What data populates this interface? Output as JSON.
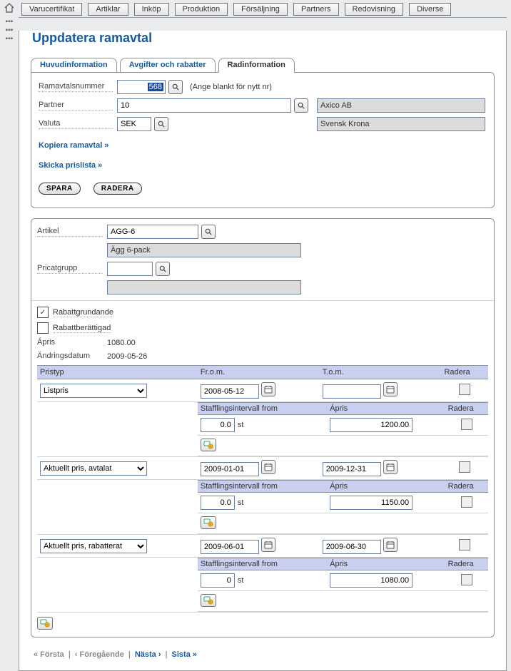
{
  "menu": [
    "Varucertifikat",
    "Artiklar",
    "Inköp",
    "Produktion",
    "Försäljning",
    "Partners",
    "Redovisning",
    "Diverse"
  ],
  "title": "Uppdatera ramavtal",
  "tabs": {
    "t1": "Huvudinformation",
    "t2": "Avgifter och rabatter",
    "t3": "Radinformation"
  },
  "head": {
    "ramavtalsnummer_label": "Ramavtalsnummer",
    "ramavtalsnummer_value": "568",
    "ramavtalsnummer_hint": "(Ange blankt för nytt nr)",
    "partner_label": "Partner",
    "partner_value": "10",
    "partner_name": "Axico AB",
    "valuta_label": "Valuta",
    "valuta_value": "SEK",
    "valuta_name": "Svensk Krona",
    "link_copy": "Kopiera ramavtal »",
    "link_skicka": "Skicka prislista »",
    "btn_save": "SPARA",
    "btn_delete": "RADERA"
  },
  "article": {
    "artikel_label": "Artikel",
    "artikel_value": "AGG-6",
    "artikel_name": "Ägg 6-pack",
    "pricatgrupp_label": "Pricatgrupp",
    "pricatgrupp_value": "",
    "pricatgrupp_name": "",
    "rabattgrund_label": "Rabattgrundande",
    "rabattberatt_label": "Rabattberättigad",
    "apris_label": "Ápris",
    "apris_value": "1080.00",
    "andring_label": "Ändringsdatum",
    "andring_value": "2009-05-26"
  },
  "priceHeaders": {
    "pristyp": "Pristyp",
    "from": "Fr.o.m.",
    "tom": "T.o.m.",
    "radera": "Radera"
  },
  "subHeaders": {
    "stafflings": "Stafflingsintervall from",
    "apris": "Ápris",
    "radera": "Radera"
  },
  "rows": [
    {
      "type": "Listpris",
      "from": "2008-05-12",
      "tom": "",
      "staff": "0.0",
      "unit": "st",
      "apris": "1200.00"
    },
    {
      "type": "Aktuellt pris, avtalat",
      "from": "2009-01-01",
      "tom": "2009-12-31",
      "staff": "0.0",
      "unit": "st",
      "apris": "1150.00"
    },
    {
      "type": "Aktuellt pris, rabatterat",
      "from": "2009-06-01",
      "tom": "2009-06-30",
      "staff": "0",
      "unit": "st",
      "apris": "1080.00"
    }
  ],
  "pager": {
    "first": "« Första",
    "prev": "‹ Föregående",
    "next": "Nästa ›",
    "last": "Sista »"
  }
}
